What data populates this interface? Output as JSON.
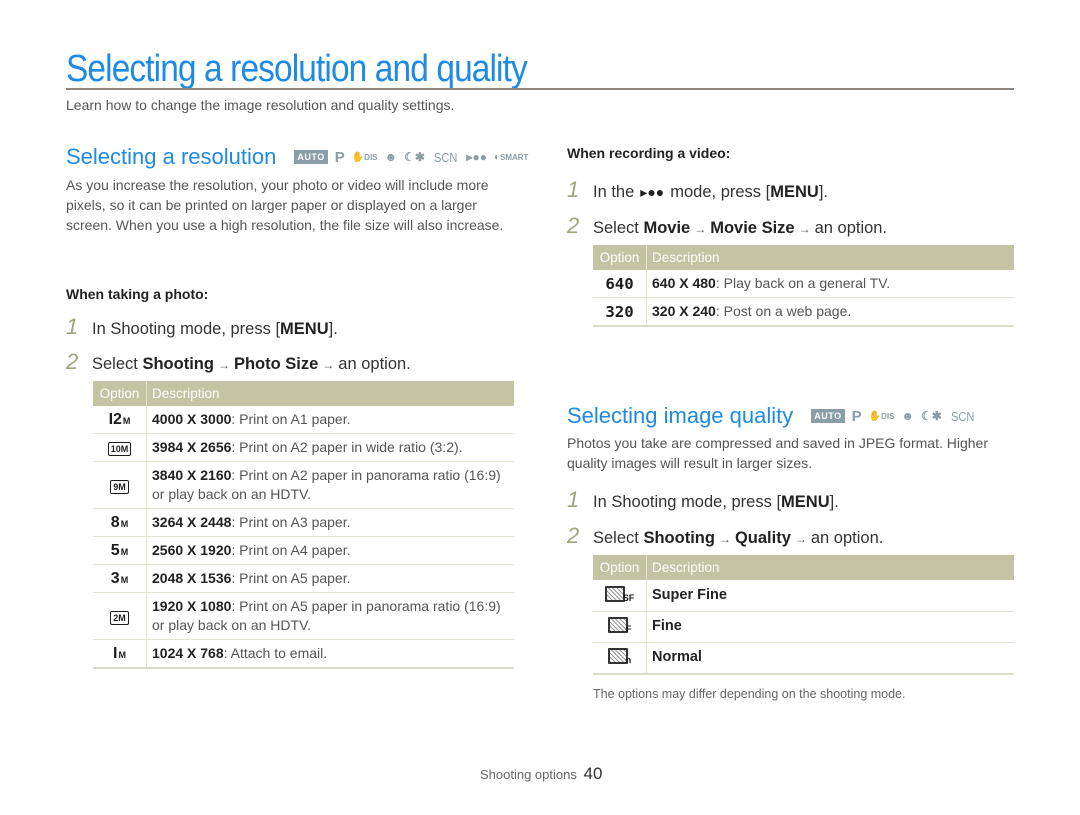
{
  "page": {
    "title": "Selecting a resolution and quality",
    "intro": "Learn how to change the image resolution and quality settings."
  },
  "modes_full": [
    "AUTO",
    "P",
    "DIS",
    "Beauty",
    "Night",
    "SCN",
    "Movie",
    "SMART"
  ],
  "modes_quality": [
    "AUTO",
    "P",
    "DIS",
    "Beauty",
    "Night",
    "SCN"
  ],
  "resolution": {
    "title": "Selecting a resolution",
    "paragraph": "As you increase the resolution, your photo or video will include more pixels, so it can be printed on larger paper or displayed on a larger screen. When you use a high resolution, the file size will also increase.",
    "photo": {
      "subhead": "When taking a photo:",
      "step1": {
        "num": "1",
        "pre": "In Shooting mode, press [",
        "key": "MENU",
        "post": "]."
      },
      "step2": {
        "num": "2",
        "pre": "Select ",
        "a": "Shooting",
        "arrow": "→",
        "b": "Photo Size",
        "post": "an option."
      },
      "table": {
        "headers": [
          "Option",
          "Description"
        ],
        "rows": [
          {
            "icon": "12M",
            "icon_name": "res-12m-icon",
            "value": "4000 X 3000",
            "desc": ": Print on A1 paper."
          },
          {
            "icon": "10M",
            "icon_name": "res-10m-wide-icon",
            "value": "3984 X 2656",
            "desc": ": Print on A2 paper in wide ratio (3:2)."
          },
          {
            "icon": "9M",
            "icon_name": "res-9m-panorama-icon",
            "value": "3840 X 2160",
            "desc": ": Print on A2 paper in panorama ratio (16:9) or play back on an HDTV."
          },
          {
            "icon": "8M",
            "icon_name": "res-8m-icon",
            "value": "3264 X 2448",
            "desc": ": Print on A3 paper."
          },
          {
            "icon": "5M",
            "icon_name": "res-5m-icon",
            "value": "2560 X 1920",
            "desc": ": Print on A4 paper."
          },
          {
            "icon": "3M",
            "icon_name": "res-3m-icon",
            "value": "2048 X 1536",
            "desc": ": Print on A5 paper."
          },
          {
            "icon": "2M",
            "icon_name": "res-2m-panorama-icon",
            "value": "1920 X 1080",
            "desc": ": Print on A5 paper in panorama ratio (16:9) or play back on an HDTV."
          },
          {
            "icon": "1M",
            "icon_name": "res-1m-icon",
            "value": "1024 X 768",
            "desc": ": Attach to email."
          }
        ]
      }
    },
    "video": {
      "subhead": "When recording a video:",
      "step1": {
        "num": "1",
        "pre": "In the",
        "post_pre": "mode, press [",
        "key": "MENU",
        "post": "]."
      },
      "step2": {
        "num": "2",
        "pre": "Select ",
        "a": "Movie",
        "arrow": "→",
        "b": "Movie Size",
        "post": "an option."
      },
      "table": {
        "headers": [
          "Option",
          "Description"
        ],
        "rows": [
          {
            "icon": "640",
            "value": "640 X 480",
            "desc": ": Play back on a general TV."
          },
          {
            "icon": "320",
            "value": "320 X 240",
            "desc": ": Post on a web page."
          }
        ]
      }
    }
  },
  "quality": {
    "title": "Selecting image quality",
    "paragraph": "Photos you take are compressed and saved in JPEG format. Higher quality images will result in larger sizes.",
    "step1": {
      "num": "1",
      "pre": "In Shooting mode, press [",
      "key": "MENU",
      "post": "]."
    },
    "step2": {
      "num": "2",
      "pre": "Select ",
      "a": "Shooting",
      "arrow": "→",
      "b": "Quality",
      "post": "an option."
    },
    "table": {
      "headers": [
        "Option",
        "Description"
      ],
      "rows": [
        {
          "suffix": "SF",
          "label": "Super Fine"
        },
        {
          "suffix": "F",
          "label": "Fine"
        },
        {
          "suffix": "n",
          "label": "Normal"
        }
      ]
    },
    "note": "The options may differ depending on the shooting mode."
  },
  "footer": {
    "section": "Shooting options",
    "page_number": "40"
  }
}
